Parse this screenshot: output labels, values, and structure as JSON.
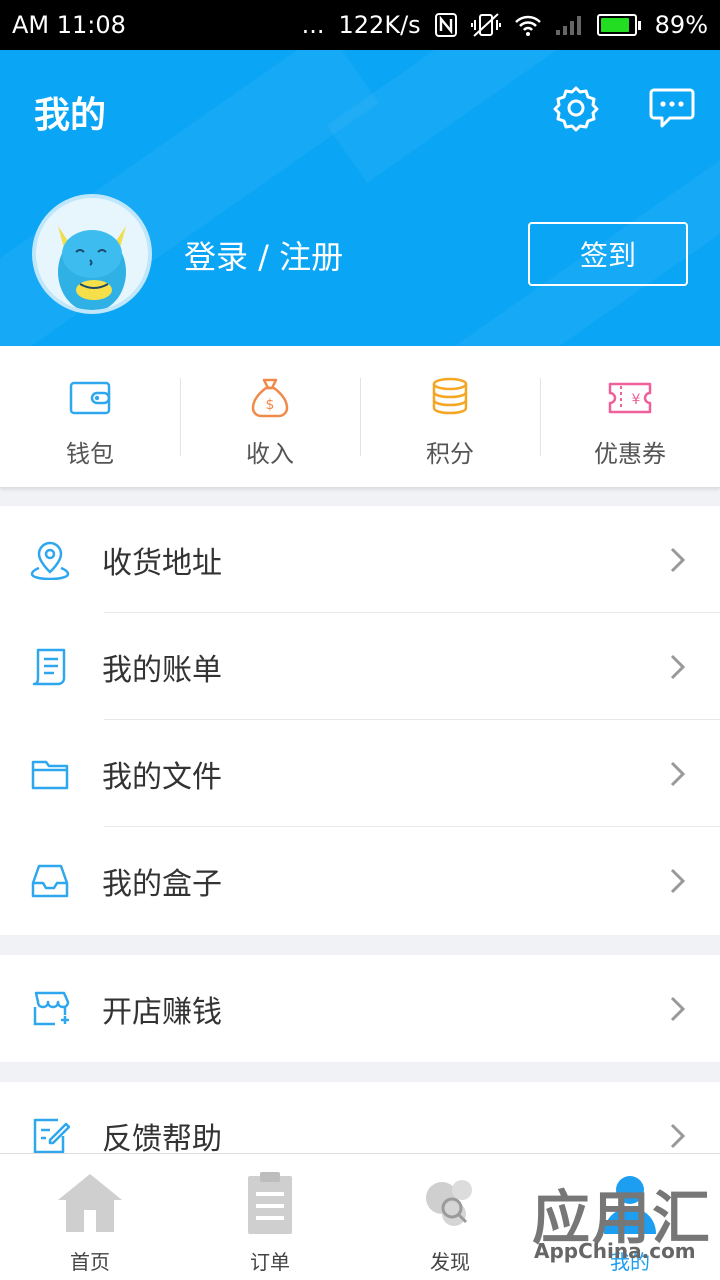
{
  "status_bar": {
    "time": "AM 11:08",
    "dots": "...",
    "speed": "122K/s",
    "battery": "89%",
    "battery_level": 0.89,
    "icons": [
      "nfc-icon",
      "mute-vibrate-icon",
      "wifi-icon",
      "signal-icon",
      "battery-icon"
    ]
  },
  "header": {
    "title": "我的",
    "login_label": "登录 / 注册",
    "signin_label": "签到",
    "bg_color": "#0aa5f5"
  },
  "quick_actions": [
    {
      "label": "钱包",
      "icon": "wallet-icon",
      "color": "#2ea7ef"
    },
    {
      "label": "收入",
      "icon": "money-bag-icon",
      "color": "#f08a4b"
    },
    {
      "label": "积分",
      "icon": "coins-icon",
      "color": "#f5a623"
    },
    {
      "label": "优惠券",
      "icon": "coupon-icon",
      "color": "#f0609a"
    }
  ],
  "menu": {
    "group1": [
      {
        "label": "收货地址",
        "icon": "location-pin-icon"
      },
      {
        "label": "我的账单",
        "icon": "bill-icon"
      },
      {
        "label": "我的文件",
        "icon": "folder-icon"
      },
      {
        "label": "我的盒子",
        "icon": "inbox-icon"
      }
    ],
    "group2": [
      {
        "label": "开店赚钱",
        "icon": "shop-icon"
      }
    ],
    "group3": [
      {
        "label": "反馈帮助",
        "icon": "feedback-icon"
      }
    ]
  },
  "bottom_nav": [
    {
      "label": "首页",
      "icon": "home-icon",
      "active": false
    },
    {
      "label": "订单",
      "icon": "clipboard-icon",
      "active": false
    },
    {
      "label": "发现",
      "icon": "discover-icon",
      "active": false
    },
    {
      "label": "我的",
      "icon": "profile-icon",
      "active": true
    }
  ],
  "watermark": {
    "title": "应用汇",
    "site": "AppChina.com"
  }
}
